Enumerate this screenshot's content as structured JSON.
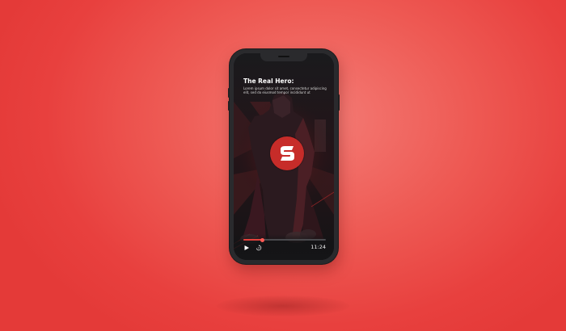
{
  "video": {
    "title": "The Real Hero:",
    "description": "Lorem ipsum dolor sit amet, consectetur adipiscing elit, sed do eiusmod tempor incididunt ut",
    "duration": "11:24",
    "progress": 0.23
  },
  "icons": {
    "logo": "s-logo-icon",
    "play": "play-icon",
    "replay": "replay-icon"
  },
  "colors": {
    "accent": "#e5403b",
    "background": "#ee5a54",
    "logo_circle": "#c72c29"
  }
}
